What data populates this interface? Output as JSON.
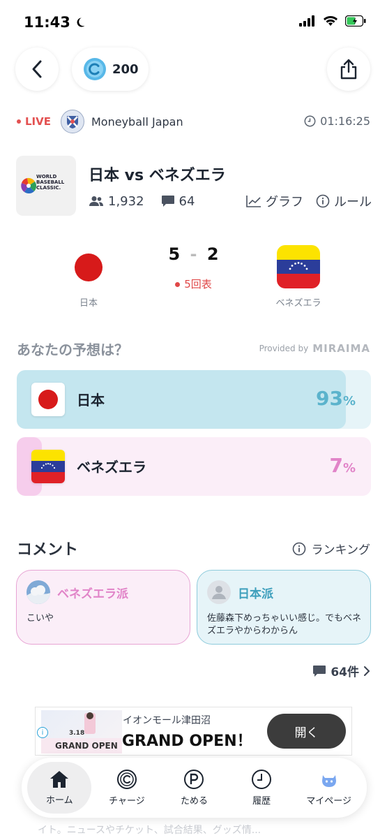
{
  "status_bar": {
    "time": "11:43"
  },
  "header": {
    "coins": "200"
  },
  "live": {
    "label": "LIVE",
    "channel": "Moneyball Japan",
    "elapsed": "01:16:25"
  },
  "match": {
    "title": "日本 vs ベネズエラ",
    "viewers": "1,932",
    "comments": "64",
    "graph_label": "グラフ",
    "rules_label": "ルール",
    "logo_text": [
      "WORLD",
      "BASEBALL",
      "CLASSIC."
    ],
    "home_team": "日本",
    "away_team": "ベネズエラ",
    "home_score": "5",
    "away_score": "2",
    "inning": "5回表"
  },
  "prediction": {
    "title": "あなたの予想は？",
    "provided_by": "Provided by",
    "provider": "MIRAIMA",
    "options": [
      {
        "team": "日本",
        "percent": "93",
        "unit": "%",
        "fill": 0.93,
        "color": "#5bb3cc"
      },
      {
        "team": "ベネズエラ",
        "percent": "7",
        "unit": "%",
        "fill": 0.07,
        "color": "#e184c8"
      }
    ]
  },
  "comments": {
    "title": "コメント",
    "ranking_label": "ランキング",
    "items": [
      {
        "team": "ベネズエラ派",
        "text": "こいや"
      },
      {
        "team": "日本派",
        "text": "佐藤森下めっちゃいい感じ。でもベネズエラやからわからん"
      }
    ],
    "count_label": "64件"
  },
  "ad": {
    "advertiser": "イオンモール津田沼",
    "headline": "GRAND OPEN！",
    "cta": "開く",
    "thumb_date": "3.18",
    "thumb_text": "GRAND OPEN"
  },
  "background_peek": "イト。ニュースやチケット、試合結果、グッズ情...",
  "bottom_nav": [
    {
      "label": "ホーム",
      "icon": "home-icon",
      "active": true
    },
    {
      "label": "チャージ",
      "icon": "coin-icon",
      "active": false
    },
    {
      "label": "ためる",
      "icon": "points-icon",
      "active": false
    },
    {
      "label": "履歴",
      "icon": "clock-icon",
      "active": false
    },
    {
      "label": "マイページ",
      "icon": "mascot-icon",
      "active": false
    }
  ],
  "colors": {
    "live_red": "#e35151",
    "japan_fill": "#c4e6ef",
    "japan_bg": "#e6f4f8",
    "venezuela_fill": "#f6cdec",
    "venezuela_bg": "#fbeef8"
  }
}
